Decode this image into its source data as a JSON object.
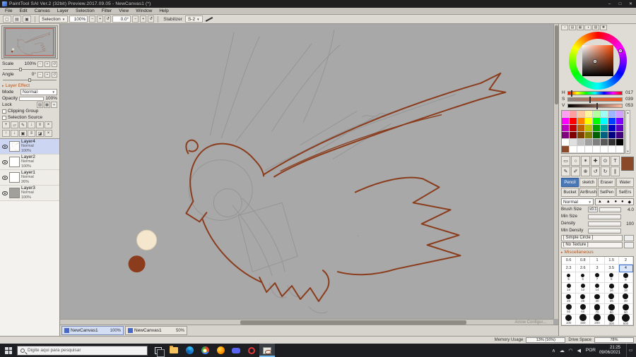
{
  "window": {
    "title": "PaintTool SAI Ver.2 (32bit) Preview.2017.09.05 - NewCanvas1 (*)",
    "minimize": "–",
    "maximize": "□",
    "close": "✕"
  },
  "menubar": {
    "items": [
      "File",
      "Edit",
      "Canvas",
      "Layer",
      "Selection",
      "Filter",
      "View",
      "Window",
      "Help"
    ]
  },
  "toolbar": {
    "left_icons": [
      "new-canvas",
      "open",
      "save"
    ],
    "selection_label": "Selection",
    "zoom_value": "100%",
    "zoom_out": "−",
    "zoom_in": "+",
    "zoom_reset": "↺",
    "angle_value": "0.0°",
    "angle_ccw": "−",
    "angle_cw": "+",
    "angle_reset": "↺",
    "stabilizer_label": "Stabilizer",
    "stabilizer_value": "S-2"
  },
  "navigator": {
    "scale_label": "Scale",
    "scale_value": "100%",
    "angle_label": "Angle",
    "angle_value": "0°"
  },
  "layer_panel": {
    "header": "Layer Effect",
    "mode_label": "Mode",
    "mode_value": "Normal",
    "opacity_label": "Opacity",
    "opacity_value": "100%",
    "lock_label": "Lock",
    "lock_icons": [
      "lock-alpha",
      "lock-pixel",
      "lock-position"
    ],
    "clipping_label": "Clipping Group",
    "selection_source_label": "Selection Source",
    "toolbar_row1": [
      "new-layer",
      "new-folder",
      "new-lineart",
      "transfer-down",
      "merge-down",
      "clear"
    ],
    "toolbar_row2": [
      "raise",
      "lower",
      "duplicate",
      "merge",
      "eraser-mode",
      "delete"
    ],
    "layers": [
      {
        "name": "Layer4",
        "mode": "Normal",
        "opacity": "100%",
        "selected": true,
        "thumb": "sketch"
      },
      {
        "name": "Layer2",
        "mode": "Normal",
        "opacity": "100%",
        "selected": false,
        "thumb": "white"
      },
      {
        "name": "Layer1",
        "mode": "Normal",
        "opacity": "26%",
        "selected": false,
        "thumb": "white"
      },
      {
        "name": "Layer3",
        "mode": "Normal",
        "opacity": "100%",
        "selected": false,
        "thumb": "gray"
      }
    ]
  },
  "canvas": {
    "corner_text": "Arrow Configur...",
    "ink_color": "#8a3c1c",
    "sketch_color": "#8f8f8f",
    "blob_cream": "#f4e7ce",
    "blob_brown": "#8a3c1c",
    "tabs": [
      {
        "label": "NewCanvas1",
        "zoom": "100%",
        "active": true
      },
      {
        "label": "NewCanvas1",
        "zoom": "50%",
        "active": false
      }
    ]
  },
  "color_panel": {
    "tab_icons": [
      "wheel-tab",
      "rgb-tab",
      "swatch-tab",
      "mixer-tab",
      "scratch-tab",
      "settings-tab"
    ],
    "h_label": "H",
    "h_value": "017",
    "s_label": "S",
    "s_value": "039",
    "v_label": "V",
    "v_value": "053",
    "current_color": "#8a4a2a",
    "palette": [
      [
        "#ff9ff3",
        "#ff9e9e",
        "#ffc79e",
        "#fff59e",
        "#b6ff9e",
        "#9efff3",
        "#9eb6ff",
        "#d49eff"
      ],
      [
        "#ff00ff",
        "#ff0000",
        "#ff8000",
        "#ffff00",
        "#00ff00",
        "#00ffff",
        "#0040ff",
        "#8000ff"
      ],
      [
        "#c000c0",
        "#c00000",
        "#c06000",
        "#c0c000",
        "#00a000",
        "#00a0a0",
        "#0000c0",
        "#6000c0"
      ],
      [
        "#800080",
        "#800000",
        "#804000",
        "#808000",
        "#006000",
        "#006080",
        "#000080",
        "#400080"
      ],
      [
        "#ffffff",
        "#e0e0e0",
        "#c0c0c0",
        "#a0a0a0",
        "#808080",
        "#585858",
        "#303030",
        "#000000"
      ],
      [
        "#8a4a2a",
        "#ffffff",
        "#ffffff",
        "#ffffff",
        "#ffffff",
        "#ffffff",
        "#ffffff",
        "#ffffff"
      ]
    ]
  },
  "tool_panel": {
    "icon_row1": [
      "rect-select",
      "lasso",
      "magic-wand",
      "move",
      "zoom",
      "text"
    ],
    "icon_row2": [
      "pen",
      "eyedropper",
      "hand",
      "rotate-ccw",
      "rotate-cw",
      "ruler"
    ],
    "tools": [
      {
        "label": "Pencil",
        "selected": true
      },
      {
        "label": "sketch",
        "selected": false
      },
      {
        "label": "Eraser",
        "selected": false
      },
      {
        "label": "Water",
        "selected": false
      },
      {
        "label": "Bucket",
        "selected": false
      },
      {
        "label": "AirBrush",
        "selected": false
      },
      {
        "label": "SelPen",
        "selected": false
      },
      {
        "label": "SelErs",
        "selected": false
      }
    ],
    "blend_mode": "Normal",
    "brush_shapes": [
      "▲",
      "▲",
      "●",
      "●",
      "◆"
    ],
    "brush_size_label": "Brush Size",
    "brush_size_unit": "x0.1",
    "brush_size_value": "4.0",
    "min_size_label": "Min Size",
    "density_label": "Density",
    "density_value": "100",
    "min_density_label": "Min Density",
    "shape_value": "[ Simple Circle ]",
    "texture_value": "[ No Texture ]",
    "misc_header": "Miscellaneous",
    "size_text_rows": [
      [
        "0.6",
        "0.8",
        "1",
        "1.5",
        "2"
      ],
      [
        "2.3",
        "2.6",
        "3",
        "3.5",
        "4"
      ]
    ],
    "size_selected": "4",
    "size_dot_rows": [
      [
        "5",
        "6",
        "7",
        "8",
        "9"
      ],
      [
        "10",
        "12",
        "14",
        "16",
        "18"
      ],
      [
        "20",
        "25",
        "30",
        "35",
        "40"
      ],
      [
        "50",
        "60",
        "70",
        "80",
        "90"
      ],
      [
        "100",
        "150",
        "200",
        "300",
        "500"
      ]
    ]
  },
  "statusbar": {
    "memory_label": "Memory Usage",
    "memory_value": "13% (16%)",
    "memory_fill_pct": 16,
    "drive_label": "Drive Space",
    "drive_value": "78%",
    "drive_fill_pct": 78
  },
  "taskbar": {
    "search_placeholder": "Digite aqui para pesquisar",
    "apps": [
      "task-view",
      "folder",
      "edge",
      "chrome",
      "firefox",
      "discord",
      "opera",
      "sai"
    ],
    "active_app": "sai",
    "tray_icons": [
      "chevron-up",
      "cloud",
      "network",
      "volume"
    ],
    "tray_lang": "POR",
    "tray_time": "21:25",
    "tray_date": "09/06/2021"
  }
}
